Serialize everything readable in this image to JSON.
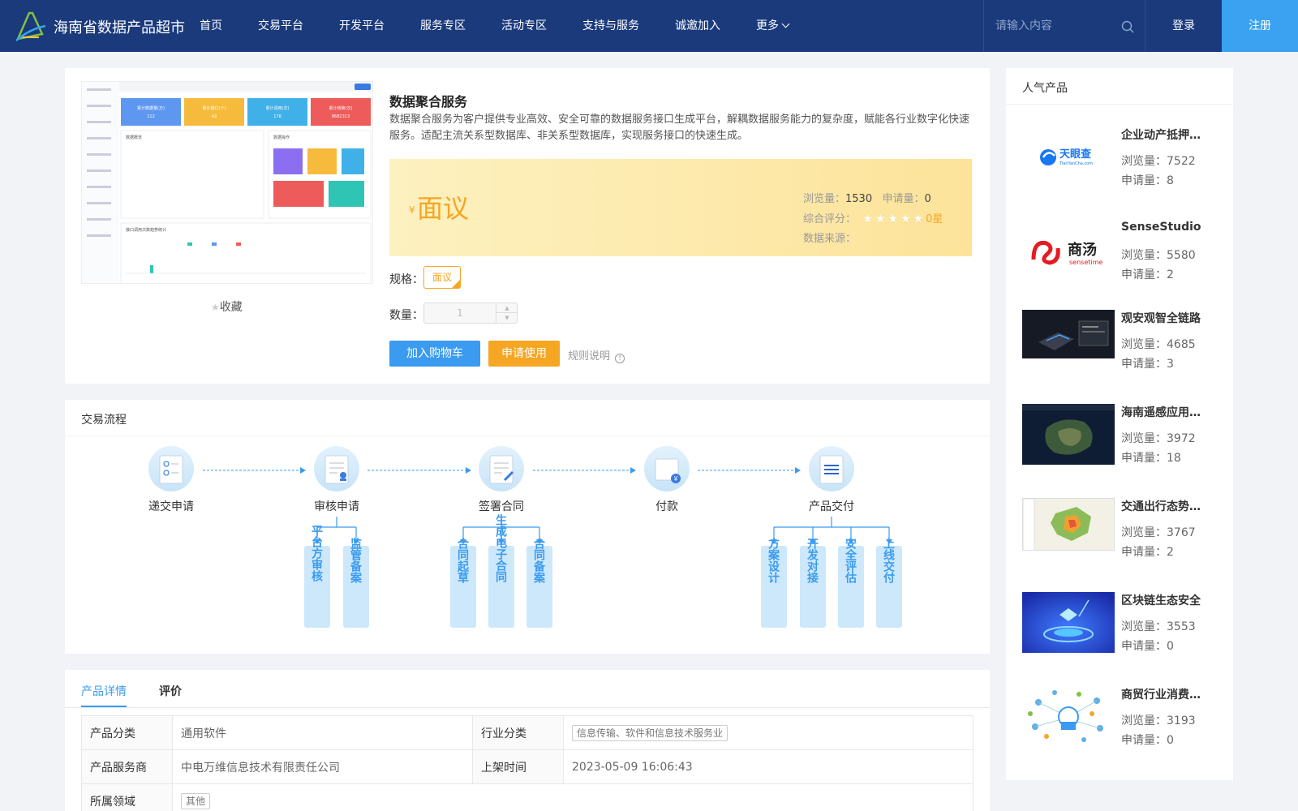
{
  "header": {
    "brand": "海南省数据产品超市",
    "nav": [
      "首页",
      "交易平台",
      "开发平台",
      "服务专区",
      "活动专区",
      "支持与服务",
      "诚邀加入",
      "更多"
    ],
    "search_placeholder": "请输入内容",
    "login": "登录",
    "register": "注册"
  },
  "product": {
    "title": "数据聚合服务",
    "description": "数据聚合服务为客户提供专业高效、安全可靠的数据服务接口生成平台，解耦数据服务能力的复杂度，赋能各行业数字化快速服务。适配主流关系型数据库、非关系型数据库，实现服务接口的快速生成。",
    "favorite": "收藏",
    "currency": "¥",
    "price": "面议",
    "views_label": "浏览量：",
    "views": "1530",
    "applies_label": "申请量：",
    "applies": "0",
    "rating_label": "综合评分：",
    "rating": "0星",
    "rating_value": 0,
    "source_label": "数据来源：",
    "spec_label": "规格：",
    "spec": "面议",
    "qty_label": "数量：",
    "qty": "1",
    "add_cart": "加入购物车",
    "apply": "申请使用",
    "rules": "规则说明",
    "screenshot_texts": {
      "kpi": [
        "累计数据量(万)",
        "累计接口(个)",
        "累计调用(次)",
        "累计转换(次)"
      ],
      "kpi_values": [
        "112",
        "42",
        "178",
        "8682313"
      ],
      "panel1": "数据概览",
      "panel2": "数据操作",
      "panel3": "接口调用次数趋势统计"
    }
  },
  "flow": {
    "title": "交易流程",
    "steps": [
      "递交申请",
      "审核申请",
      "签署合同",
      "付款",
      "产品交付"
    ],
    "sub": {
      "review": [
        "平台方审核",
        "监管备案"
      ],
      "contract": [
        "合同起草",
        "生成电子合同",
        "合同备案"
      ],
      "delivery": [
        "方案设计",
        "开发对接",
        "安全评估",
        "上线交付"
      ]
    }
  },
  "detail": {
    "tabs": [
      "产品详情",
      "评价"
    ],
    "rows": [
      {
        "k1": "产品分类",
        "v1": "通用软件",
        "k2": "行业分类",
        "v2": "信息传输、软件和信息技术服务业"
      },
      {
        "k1": "产品服务商",
        "v1": "中电万维信息技术有限责任公司",
        "k2": "上架时间",
        "v2": "2023-05-09 16:06:43"
      },
      {
        "k1": "所属领域",
        "v1": "其他"
      }
    ]
  },
  "hot": {
    "title": "人气产品",
    "views_label": "浏览量：",
    "applies_label": "申请量：",
    "items": [
      {
        "name": "企业动产抵押信息",
        "views": "7522",
        "applies": "8",
        "logo": "天眼查",
        "logo_sub": "TianYanCha.com"
      },
      {
        "name": "SenseStudio",
        "views": "5580",
        "applies": "2",
        "logo": "商汤",
        "logo_sub": "sensetime"
      },
      {
        "name": "观安观智全链路",
        "views": "4685",
        "applies": "3"
      },
      {
        "name": "海南遥感应用服务",
        "views": "3972",
        "applies": "18"
      },
      {
        "name": "交通出行态势分析",
        "views": "3767",
        "applies": "2"
      },
      {
        "name": "区块链生态安全",
        "views": "3553",
        "applies": "0"
      },
      {
        "name": "商贸行业消费分析",
        "views": "3193",
        "applies": "0"
      }
    ]
  },
  "colors": {
    "primary": "#1a3a7c",
    "accent": "#3a9bf0",
    "orange": "#f5a623"
  }
}
